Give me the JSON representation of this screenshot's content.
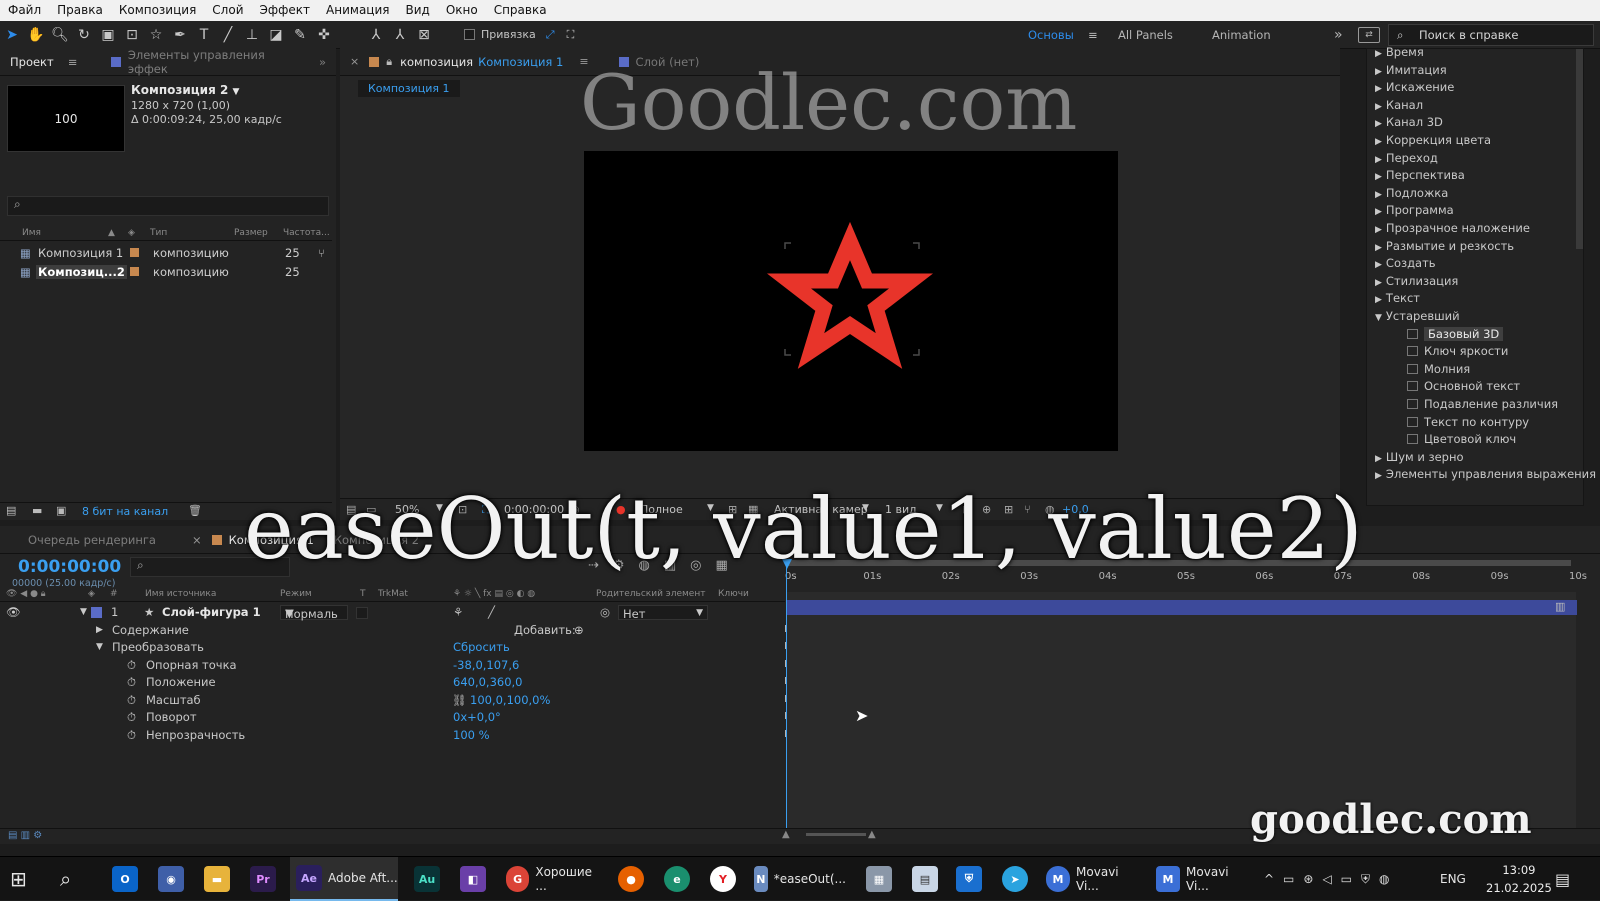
{
  "menu": [
    "Файл",
    "Правка",
    "Композиция",
    "Слой",
    "Эффект",
    "Анимация",
    "Вид",
    "Окно",
    "Справка"
  ],
  "toolbar": {
    "snap_label": "Привязка",
    "workspaces": [
      "Основы",
      "All Panels",
      "Animation"
    ],
    "active_workspace": "Основы",
    "help_search_placeholder": "Поиск в справке"
  },
  "project": {
    "tab_label": "Проект",
    "tab2_label": "Элементы управления эффек",
    "thumb_label": "100",
    "selected_name": "Композиция 2",
    "selected_res": "1280 x 720 (1,00)",
    "selected_duration": "Δ 0:00:09:24, 25,00 кадр/с",
    "search_icon": "⌕",
    "columns": [
      "Имя",
      "Тип",
      "Размер",
      "Частота..."
    ],
    "rows": [
      {
        "name": "Композиция 1",
        "type": "композицию",
        "fps": "25",
        "color": "#c7884f"
      },
      {
        "name": "Композиц...2",
        "type": "композицию",
        "fps": "25",
        "color": "#c7884f"
      }
    ],
    "footer_depth": "8 бит на канал"
  },
  "viewer": {
    "tab_prefix": "композиция",
    "tab_name": "Композиция 1",
    "tab2_label": "Слой (нет)",
    "breadcrumb": "Композиция 1",
    "zoom": "50%",
    "timecode": "0:00:00:00",
    "resolution": "Полное",
    "camera": "Активная камер",
    "views": "1 вид",
    "exposure": "+0,0",
    "shape_color": "#e8342a"
  },
  "effects": {
    "items": [
      {
        "label": "Время",
        "open": false
      },
      {
        "label": "Имитация",
        "open": false
      },
      {
        "label": "Искажение",
        "open": false
      },
      {
        "label": "Канал",
        "open": false
      },
      {
        "label": "Канал 3D",
        "open": false
      },
      {
        "label": "Коррекция цвета",
        "open": false
      },
      {
        "label": "Переход",
        "open": false
      },
      {
        "label": "Перспектива",
        "open": false
      },
      {
        "label": "Подложка",
        "open": false
      },
      {
        "label": "Программа",
        "open": false
      },
      {
        "label": "Прозрачное наложение",
        "open": false
      },
      {
        "label": "Размытие и резкость",
        "open": false
      },
      {
        "label": "Создать",
        "open": false
      },
      {
        "label": "Стилизация",
        "open": false
      },
      {
        "label": "Текст",
        "open": false
      },
      {
        "label": "Устаревший",
        "open": true
      }
    ],
    "sub_items": [
      "Базовый 3D",
      "Ключ яркости",
      "Молния",
      "Основной текст",
      "Подавление различия",
      "Текст по контуру",
      "Цветовой ключ"
    ],
    "tail_items": [
      "Шум и зерно",
      "Элементы управления выражения"
    ]
  },
  "timeline": {
    "tab1_label": "Очередь рендеринга",
    "tab2_label": "Композиция 1",
    "tab3_label": "Композиция 2",
    "timecode": "0:00:00:00",
    "timecode_sub": "00000 (25.00 кадр/с)",
    "columns": [
      "#",
      "Имя источника",
      "Режим",
      "T",
      "TrkMat",
      "Родительский элемент",
      "Ключи"
    ],
    "layer": {
      "index": "1",
      "name": "Слой-фигура 1",
      "mode": "Нормаль",
      "parent": "Нет"
    },
    "contents_label": "Содержание",
    "add_label": "Добавить:",
    "transform_label": "Преобразовать",
    "reset_label": "Сбросить",
    "props": [
      {
        "name": "Опорная точка",
        "value": "-38,0,107,6"
      },
      {
        "name": "Положение",
        "value": "640,0,360,0"
      },
      {
        "name": "Масштаб",
        "value": "100,0,100,0%"
      },
      {
        "name": "Поворот",
        "value": "0x+0,0°"
      },
      {
        "name": "Непрозрачность",
        "value": "100 %"
      }
    ],
    "ruler": [
      "0s",
      "01s",
      "02s",
      "03s",
      "04s",
      "05s",
      "06s",
      "07s",
      "08s",
      "09s",
      "10s"
    ],
    "layer_color": "#3d4a9b"
  },
  "watermarks": {
    "top": "Goodlec.com",
    "caption": "easeOut(t, value1, value2)",
    "bottom": "goodlec.com"
  },
  "taskbar": {
    "apps": [
      {
        "label": "Adobe Aft...",
        "icon": "Ae",
        "color": "#2a1f5c",
        "active": true
      },
      {
        "label": "Хорошие ...",
        "icon": "G",
        "color": "#db4437",
        "active": false
      },
      {
        "label": "*easeOut(...",
        "icon": "N",
        "color": "#6a8bbf",
        "active": false
      },
      {
        "label": "Movavi Vi...",
        "icon": "M",
        "color": "#3b6fd6",
        "active": false
      },
      {
        "label": "Movavi Vi...",
        "icon": "M",
        "color": "#3b6fd6",
        "active": false
      }
    ],
    "lang": "ENG",
    "time": "13:09",
    "date": "21.02.2025"
  }
}
